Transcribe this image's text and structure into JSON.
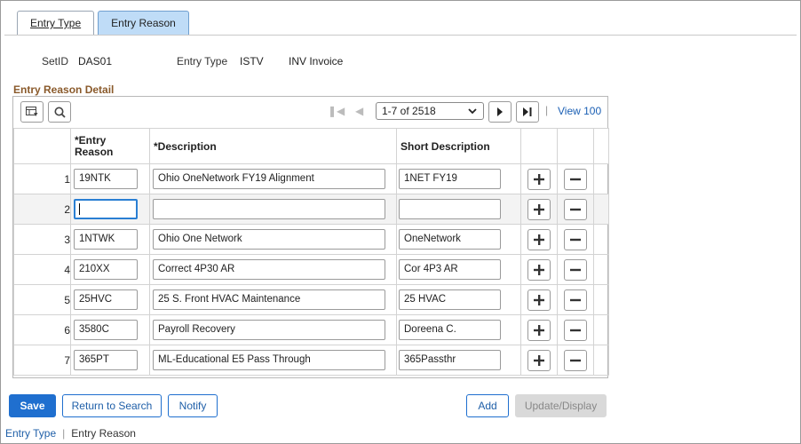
{
  "tabs": [
    {
      "label": "Entry Type"
    },
    {
      "label": "Entry Reason"
    }
  ],
  "header": {
    "setid_label": "SetID",
    "setid_value": "DAS01",
    "entry_type_label": "Entry Type",
    "entry_type_value": "ISTV",
    "entry_type_desc": "INV Invoice"
  },
  "section_title": "Entry Reason Detail",
  "grid": {
    "range": "1-7 of 2518",
    "view_all": "View 100",
    "columns": {
      "entry_reason": "*Entry Reason",
      "description": "*Description",
      "short_description": "Short Description"
    },
    "rows": [
      {
        "num": "1",
        "reason": "19NTK",
        "description": "Ohio OneNetwork FY19 Alignment",
        "short": "1NET FY19"
      },
      {
        "num": "2",
        "reason": "",
        "description": "",
        "short": ""
      },
      {
        "num": "3",
        "reason": "1NTWK",
        "description": "Ohio One Network",
        "short": "OneNetwork"
      },
      {
        "num": "4",
        "reason": "210XX",
        "description": "Correct 4P30 AR",
        "short": "Cor 4P3 AR"
      },
      {
        "num": "5",
        "reason": "25HVC",
        "description": "25 S. Front HVAC Maintenance",
        "short": "25 HVAC"
      },
      {
        "num": "6",
        "reason": "3580C",
        "description": "Payroll Recovery",
        "short": "Doreena C."
      },
      {
        "num": "7",
        "reason": "365PT",
        "description": "ML-Educational E5 Pass Through",
        "short": "365Passthr"
      }
    ]
  },
  "buttons": {
    "save": "Save",
    "return_to_search": "Return to Search",
    "notify": "Notify",
    "add": "Add",
    "update_display": "Update/Display"
  },
  "footer": {
    "link": "Entry Type",
    "current": "Entry Reason"
  },
  "colors": {
    "primary": "#1f6fcf",
    "active_tab": "#bfdcf7",
    "section_title": "#8a5a2b"
  }
}
